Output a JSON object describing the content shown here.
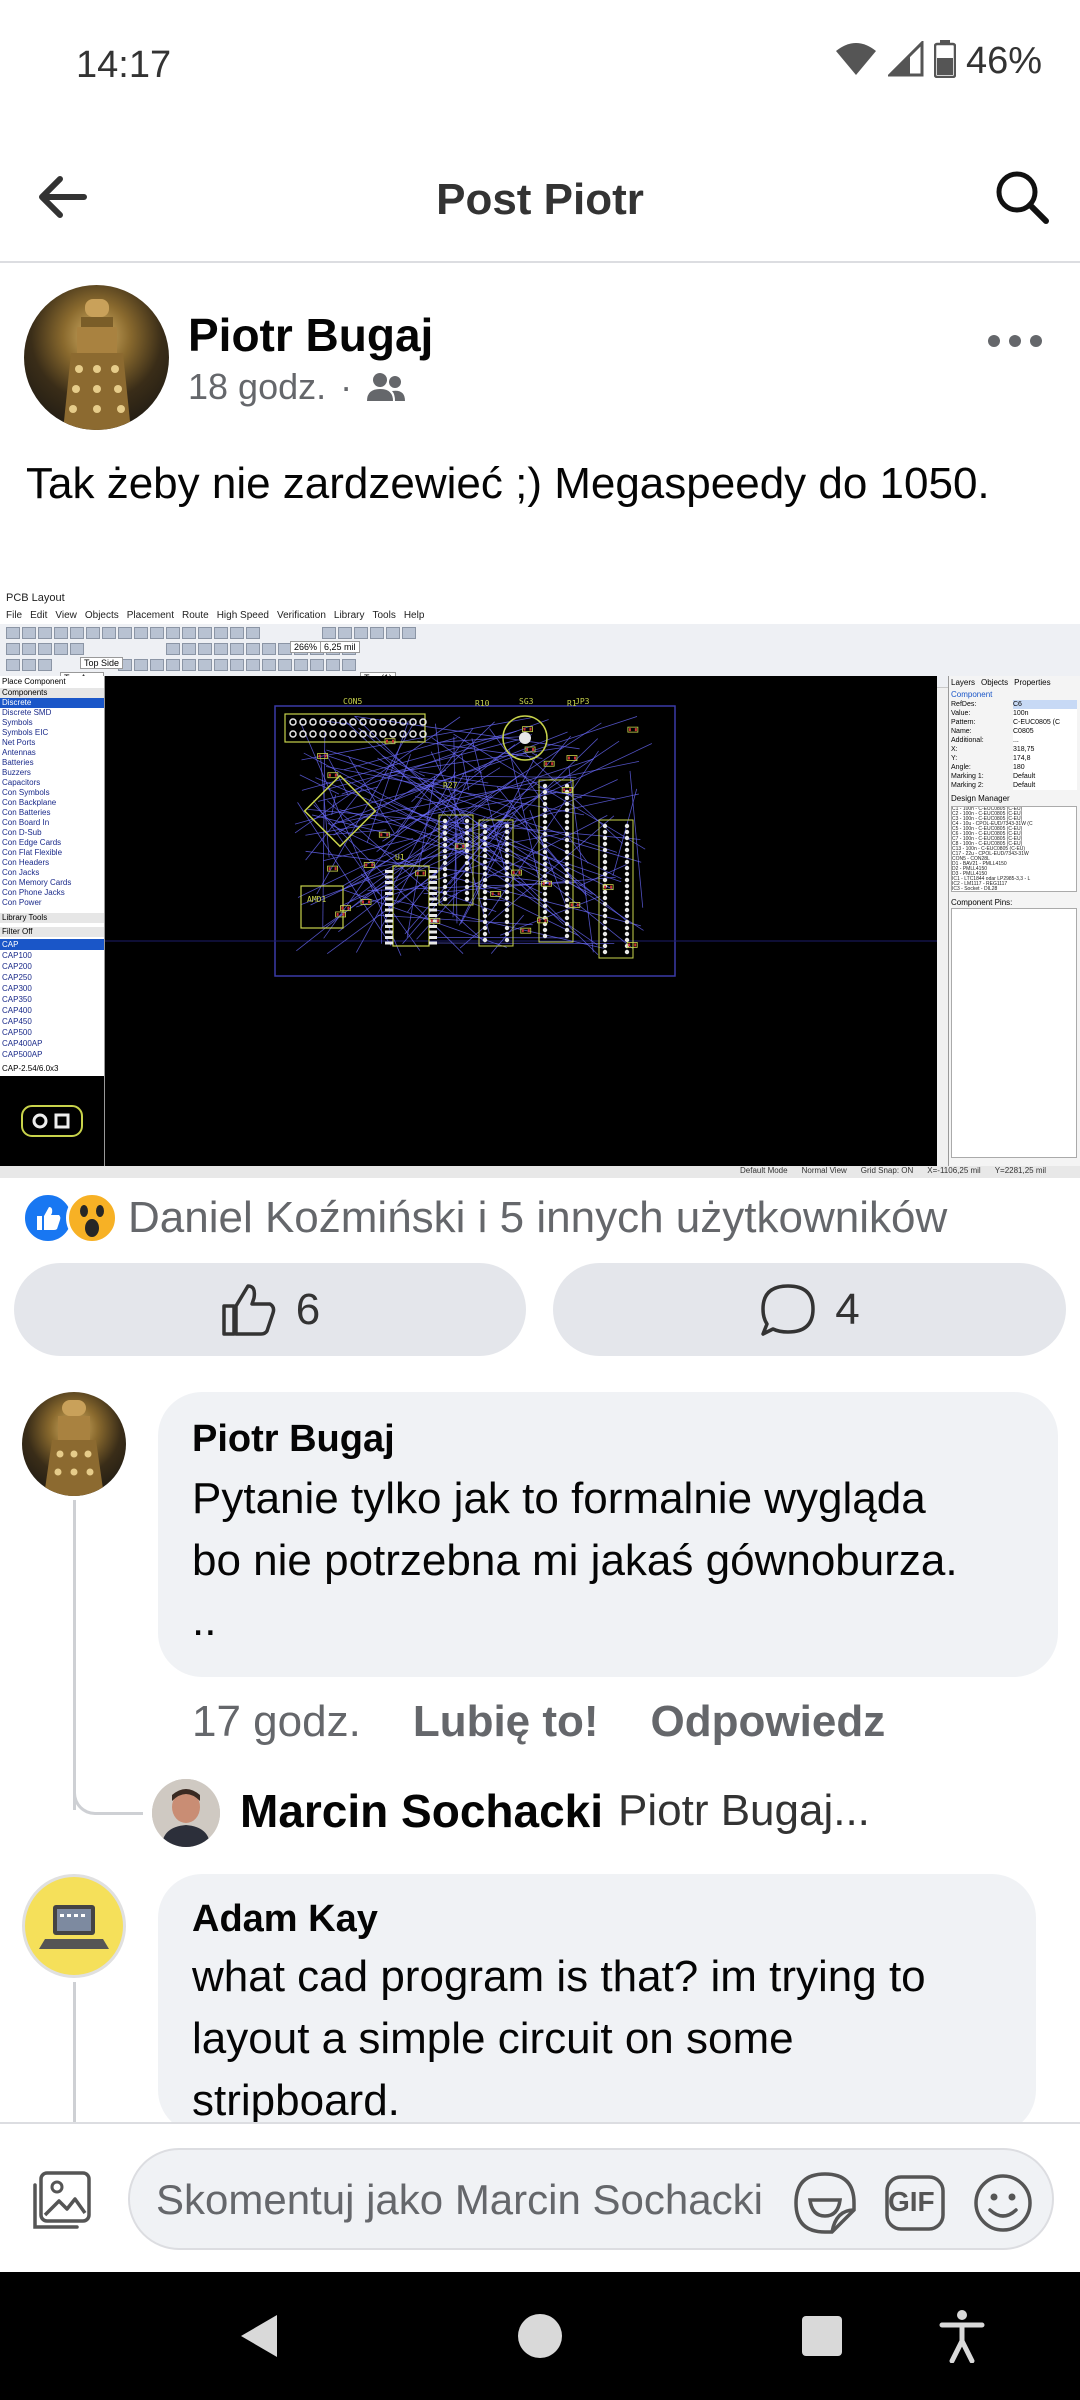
{
  "status": {
    "time": "14:17",
    "battery": "46%"
  },
  "header": {
    "title": "Post Piotr"
  },
  "post": {
    "author": "Piotr Bugaj",
    "time": "18 godz.",
    "separator": "·",
    "text": "Tak żeby nie zardzewieć ;) Megaspeedy do 1050.",
    "image": {
      "window_title": "PCB Layout",
      "menu": [
        "File",
        "Edit",
        "View",
        "Objects",
        "Placement",
        "Route",
        "High Speed",
        "Verification",
        "Library",
        "Tools",
        "Help"
      ],
      "zoom": "266%",
      "grid": "6,25 mil",
      "layer_select": "Top Side",
      "assy_select": "Top Assy",
      "layer_top": "Top (1)",
      "left_panel_title": "Place Component",
      "left_panel_header": "Components",
      "component_types": [
        "Discrete",
        "Discrete SMD",
        "Symbols",
        "Symbols EIC",
        "Net Ports",
        "Antennas",
        "Batteries",
        "Buzzers",
        "Capacitors",
        "Con Symbols",
        "Con Backplane",
        "Con Batteries",
        "Con Board In",
        "Con D-Sub",
        "Con Edge Cards",
        "Con Flat Flexible",
        "Con Headers",
        "Con Jacks",
        "Con Memory Cards",
        "Con Phone Jacks",
        "Con Power"
      ],
      "library_tools": "Library Tools",
      "filter": "Filter Off",
      "cap_list": [
        "CAP",
        "CAP100",
        "CAP200",
        "CAP250",
        "CAP300",
        "CAP350",
        "CAP400",
        "CAP450",
        "CAP500",
        "CAP400AP",
        "CAP500AP"
      ],
      "footprint_label": "CAP-2.54/6.0x3",
      "board_labels": [
        "CON5",
        "R10",
        "SG3",
        "R1",
        "JP3",
        "U1",
        "AMD1",
        "R27"
      ],
      "right_tabs": [
        "Layers",
        "Objects",
        "Properties"
      ],
      "component_header": "Component",
      "properties": [
        {
          "key": "RefDes:",
          "value": "C6"
        },
        {
          "key": "Value:",
          "value": "100n"
        },
        {
          "key": "Pattern:",
          "value": "C-EUC0805 (C"
        },
        {
          "key": "Name:",
          "value": "C0805"
        },
        {
          "key": "Additional:",
          "value": "..."
        },
        {
          "key": "X:",
          "value": "318,75"
        },
        {
          "key": "Y:",
          "value": "174,8"
        },
        {
          "key": "Angle:",
          "value": "180"
        },
        {
          "key": "Marking 1:",
          "value": "Default"
        },
        {
          "key": "Marking 2:",
          "value": "Default"
        }
      ],
      "design_manager": "Design Manager",
      "dm_items": [
        "C1 - 100n - C-EUC0805 (C-EU)",
        "C2 - 100n - C-EUC0805 (C-EU)",
        "C3 - 100n - C-EUC0805 (C-EU)",
        "C4 - 10u - CPOL-EUD/7343-31W (C",
        "C5 - 100n - C-EUC0805 (C-EU)",
        "C6 - 100n - C-EUC0805 (C-EU)",
        "C7 - 100n - C-EUC0805 (C-EU)",
        "C8 - 100n - C-EUC0805 (C-EU)",
        "C13 - 100n - C-EUC0805 (C-EU)",
        "C17 - 22u - CPOL-EUD/7343-31W",
        "CON5 - CON28L",
        "D1 - BAV21 - PMLL4150",
        "D2 - PMLL4150",
        "D3 - PMLL4150",
        "IC1 - LTC1844 odar LP2985-3,3 - L",
        "IC2 - LM1117 - REG1117",
        "IC3 - Socket - DIL28"
      ],
      "component_pins": "Component Pins:",
      "statusbar": [
        "Default Mode",
        "Normal View",
        "Grid Snap: ON",
        "X=-1106,25 mil",
        "Y=2281,25 mil"
      ]
    },
    "reactions": {
      "text": "Daniel Koźmiński i 5 innych użytkowników",
      "icons": [
        "like-reaction",
        "wow-reaction"
      ]
    },
    "like_count": "6",
    "comment_count": "4"
  },
  "comments": [
    {
      "author": "Piotr Bugaj",
      "lines": [
        "Pytanie tylko jak to formalnie wygląda",
        "bo nie potrzebna mi jakaś gównoburza.",
        ".."
      ],
      "time": "17 godz.",
      "like_action": "Lubię to!",
      "reply_action": "Odpowiedz",
      "reply_preview": {
        "author": "Marcin Sochacki",
        "text": "Piotr Bugaj..."
      }
    },
    {
      "author": "Adam Kay",
      "lines": [
        "what cad program is that? im trying to",
        "layout a simple circuit on some",
        "stripboard."
      ]
    }
  ],
  "composer": {
    "placeholder": "Skomentuj jako Marcin Sochacki",
    "gif_label": "GIF"
  },
  "colors": {
    "accent": "#1877f2",
    "wow": "#f7b125",
    "pcb_bg": "#000000",
    "trace": "#6b6bff",
    "silk": "#c8d34b",
    "pad": "#e8e8e8"
  }
}
